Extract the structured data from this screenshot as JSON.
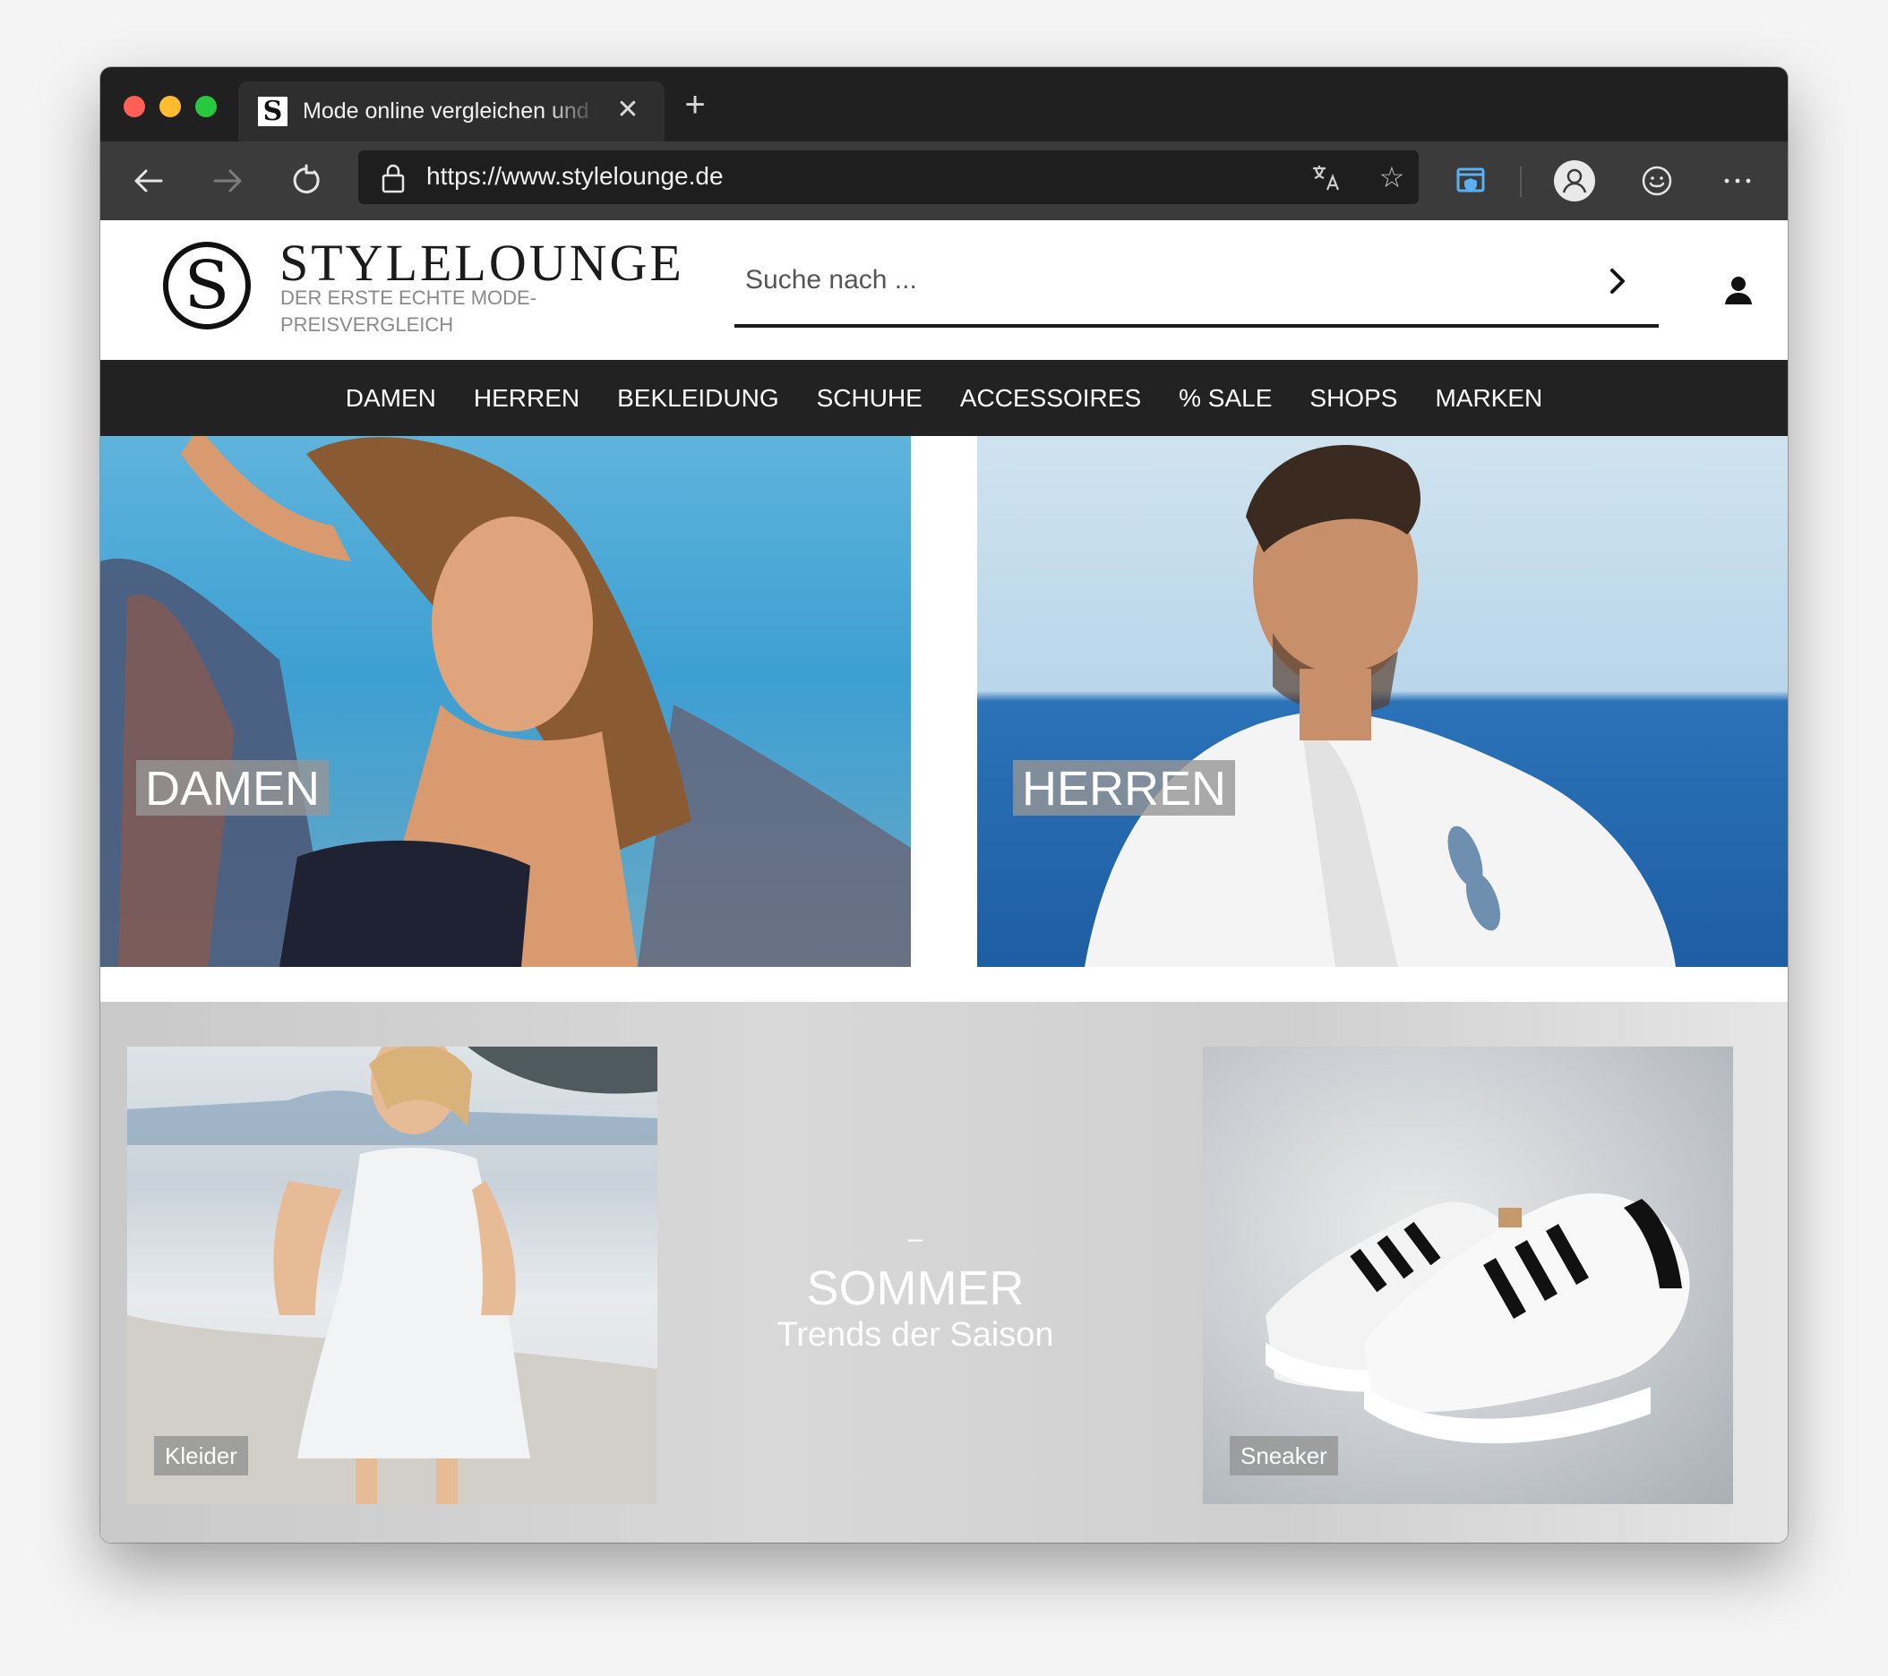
{
  "browser": {
    "tab_title": "Mode online vergleichen und bei Top-Shops kaufen",
    "tab_favicon": "S",
    "url_scheme": "https://",
    "url_host": "www.stylelounge.de"
  },
  "header": {
    "logo_mark": "S",
    "logo_title": "STYLELOUNGE",
    "logo_subtitle": "DER ERSTE ECHTE MODE-PREISVERGLEICH",
    "search_placeholder": "Suche nach ..."
  },
  "nav": {
    "items": [
      "DAMEN",
      "HERREN",
      "BEKLEIDUNG",
      "SCHUHE",
      "ACCESSOIRES",
      "% SALE",
      "SHOPS",
      "MARKEN"
    ]
  },
  "hero": {
    "left_label": "DAMEN",
    "right_label": "HERREN"
  },
  "band": {
    "left_tile_label": "Kleider",
    "right_tile_label": "Sneaker",
    "promo_dash": "–",
    "promo_title": "SOMMER",
    "promo_subtitle": "Trends der Saison"
  },
  "colors": {
    "chrome_dark": "#202020",
    "toolbar": "#3b3b3b",
    "nav_bg": "#222222",
    "label_bg": "#969696"
  }
}
